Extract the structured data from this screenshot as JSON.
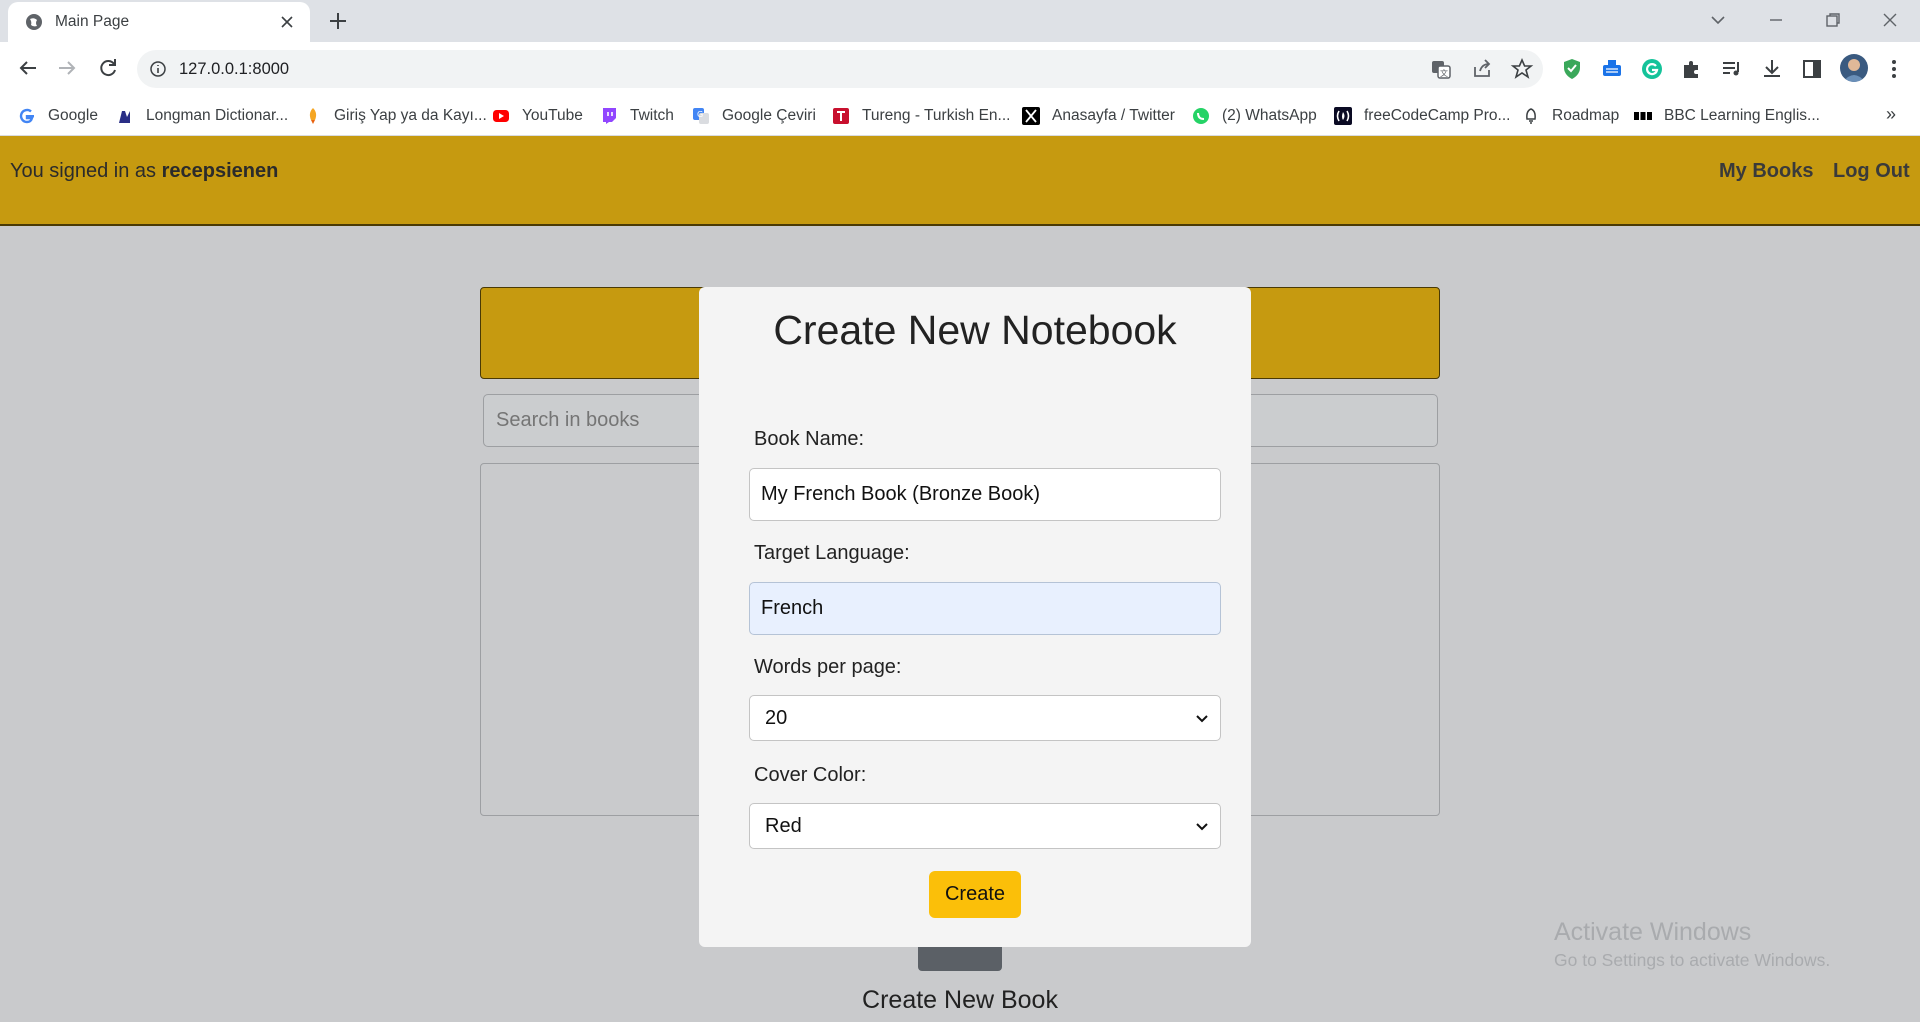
{
  "browser": {
    "tab_title": "Main Page",
    "url": "127.0.0.1:8000",
    "bookmarks": [
      {
        "label": "Google",
        "icon": "google-icon"
      },
      {
        "label": "Longman Dictionar...",
        "icon": "longman-icon"
      },
      {
        "label": "Giriş Yap ya da Kayı...",
        "icon": "rocket-icon"
      },
      {
        "label": "YouTube",
        "icon": "youtube-icon"
      },
      {
        "label": "Twitch",
        "icon": "twitch-icon"
      },
      {
        "label": "Google Çeviri",
        "icon": "translate-icon"
      },
      {
        "label": "Tureng - Turkish En...",
        "icon": "tureng-icon"
      },
      {
        "label": "Anasayfa / Twitter",
        "icon": "x-icon"
      },
      {
        "label": "(2) WhatsApp",
        "icon": "whatsapp-icon"
      },
      {
        "label": "freeCodeCamp Pro...",
        "icon": "freecodecamp-icon"
      },
      {
        "label": "Roadmap",
        "icon": "roadmap-icon"
      },
      {
        "label": "BBC Learning Englis...",
        "icon": "bbc-icon"
      }
    ],
    "more_bookmarks": "»"
  },
  "header": {
    "signed_prefix": "You signed in as",
    "username": "recepsienen",
    "my_books": "My Books",
    "log_out": "Log Out"
  },
  "main": {
    "search_placeholder": "Search in books",
    "create_new_book": "Create New Book"
  },
  "modal": {
    "title": "Create New Notebook",
    "book_name_label": "Book Name:",
    "book_name_value": "My French Book (Bronze Book)",
    "target_language_label": "Target Language:",
    "target_language_value": "French",
    "words_per_page_label": "Words per page:",
    "words_per_page_value": "20",
    "cover_color_label": "Cover Color:",
    "cover_color_value": "Red",
    "create_button": "Create"
  },
  "watermark": {
    "title": "Activate Windows",
    "subtitle": "Go to Settings to activate Windows."
  },
  "colors": {
    "header_bg": "#c69a10",
    "page_bg": "#c9cacc",
    "modal_bg": "#f4f4f4",
    "button_bg": "#fbbf09"
  }
}
